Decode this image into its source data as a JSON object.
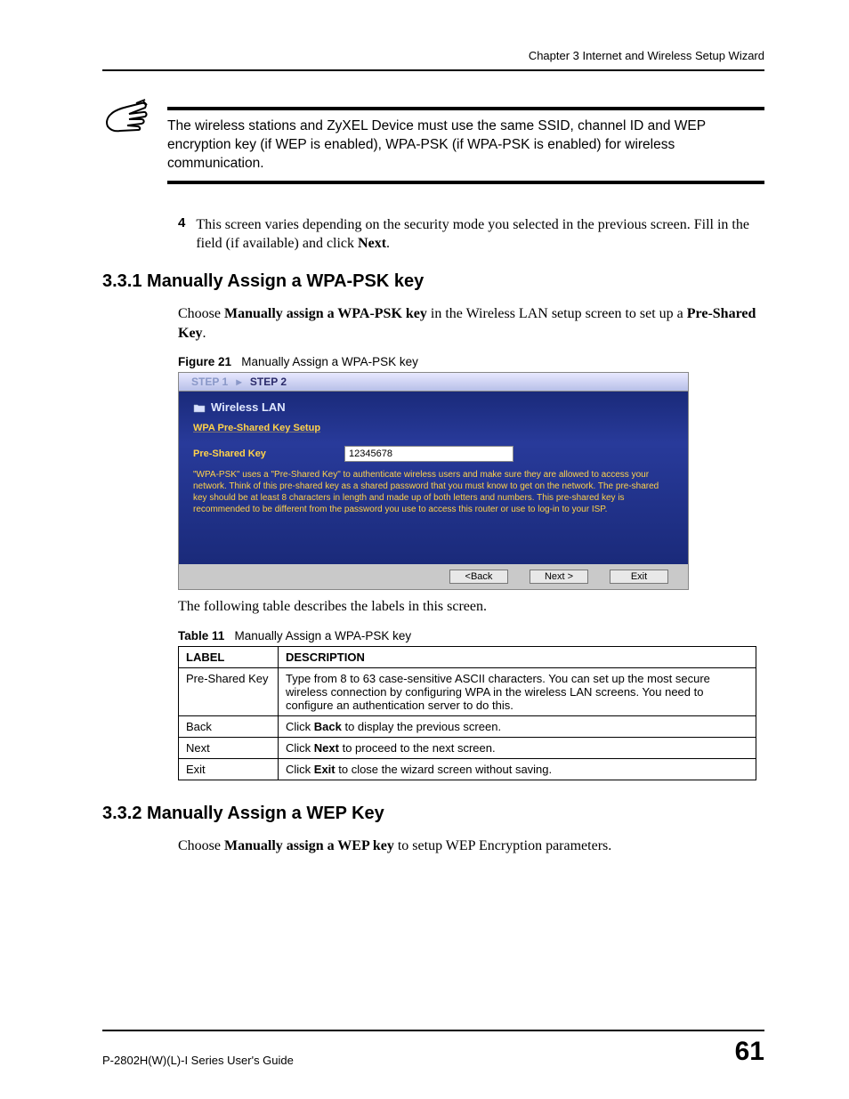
{
  "header": {
    "chapter": "Chapter 3 Internet and Wireless Setup Wizard"
  },
  "note": {
    "text": "The wireless stations and ZyXEL Device must use the same SSID, channel ID and WEP encryption key (if WEP is enabled), WPA-PSK (if WPA-PSK is enabled) for wireless communication."
  },
  "step4": {
    "num": "4",
    "text_a": "This screen varies depending on the security mode you selected in the previous screen. Fill in the field (if available) and click ",
    "bold": "Next",
    "text_b": "."
  },
  "section331": {
    "heading": "3.3.1  Manually Assign a WPA-PSK key",
    "intro_a": "Choose ",
    "intro_bold1": "Manually assign a WPA-PSK key",
    "intro_b": " in the Wireless LAN setup screen to set up a ",
    "intro_bold2": "Pre-Shared Key",
    "intro_c": "."
  },
  "figure21": {
    "label": "Figure 21",
    "caption": "Manually Assign a WPA-PSK key",
    "steps": {
      "step1": "STEP 1",
      "arrow": "▸",
      "step2": "STEP 2"
    },
    "panel_title": "Wireless LAN",
    "panel_sub": "WPA Pre-Shared Key Setup",
    "field_label": "Pre-Shared Key",
    "field_value": "12345678",
    "help": "\"WPA-PSK\" uses a \"Pre-Shared Key\" to authenticate wireless users and make sure they are allowed to access your network. Think of this pre-shared key as a shared password that you must know to get on the network. The pre-shared key should be at least 8 characters in length and made up of both letters and numbers. This pre-shared key is recommended to be different from the password you use to access this router or use to log-in to your ISP.",
    "buttons": {
      "back": "<Back",
      "next": "Next >",
      "exit": "Exit"
    }
  },
  "table11": {
    "label": "Table 11",
    "caption": "Manually Assign a WPA-PSK key",
    "intro": "The following table describes the labels in this screen.",
    "headers": {
      "label": "LABEL",
      "desc": "DESCRIPTION"
    },
    "rows": [
      {
        "label": "Pre-Shared Key",
        "desc": "Type from 8 to 63 case-sensitive ASCII characters. You can set up the most secure wireless connection by configuring WPA in the wireless LAN screens. You need to configure an authentication server to do this."
      },
      {
        "label": "Back",
        "desc_a": "Click ",
        "desc_bold": "Back",
        "desc_b": " to display the previous screen."
      },
      {
        "label": "Next",
        "desc_a": "Click ",
        "desc_bold": "Next",
        "desc_b": " to proceed to the next screen."
      },
      {
        "label": "Exit",
        "desc_a": "Click ",
        "desc_bold": "Exit",
        "desc_b": " to close the wizard screen without saving."
      }
    ]
  },
  "section332": {
    "heading": "3.3.2  Manually Assign a WEP Key",
    "intro_a": "Choose ",
    "intro_bold": "Manually assign a WEP key",
    "intro_b": " to setup WEP Encryption parameters."
  },
  "footer": {
    "guide": "P-2802H(W)(L)-I Series User's Guide",
    "page": "61"
  }
}
